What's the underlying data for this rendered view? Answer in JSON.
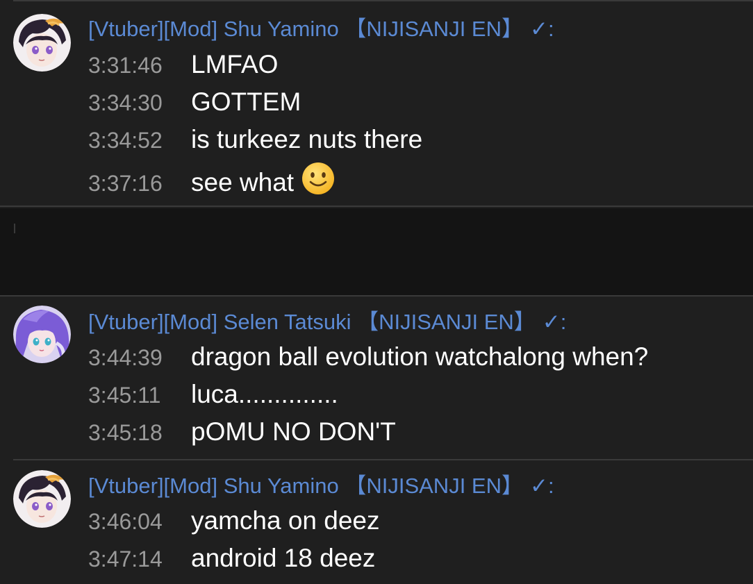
{
  "groups": [
    {
      "author": "[Vtuber][Mod] Shu Yamino 【NIJISANJI EN】",
      "check": "✓:",
      "avatar": "shu-yamino-avatar",
      "messages": [
        {
          "time": "3:31:46",
          "text": "LMFAO"
        },
        {
          "time": "3:34:30",
          "text": "GOTTEM"
        },
        {
          "time": "3:34:52",
          "text": "is turkeez nuts there"
        },
        {
          "time": "3:37:16",
          "text": "see what",
          "emoji": "slightly-smiling-face"
        }
      ]
    },
    {
      "author": "[Vtuber][Mod] Selen Tatsuki 【NIJISANJI EN】",
      "check": "✓:",
      "avatar": "selen-tatsuki-avatar",
      "messages": [
        {
          "time": "3:44:39",
          "text": "dragon ball evolution watchalong when?"
        },
        {
          "time": "3:45:11",
          "text": "luca.............."
        },
        {
          "time": "3:45:18",
          "text": "pOMU NO DON'T"
        }
      ]
    },
    {
      "author": "[Vtuber][Mod] Shu Yamino 【NIJISANJI EN】",
      "check": "✓:",
      "avatar": "shu-yamino-avatar",
      "messages": [
        {
          "time": "3:46:04",
          "text": "yamcha on deez"
        },
        {
          "time": "3:47:14",
          "text": "android 18 deez"
        }
      ]
    }
  ],
  "colors": {
    "background": "#1f1f1f",
    "author": "#5b8ad4",
    "timestamp": "#9a9a9a",
    "message": "#ffffff",
    "divider": "#3a3a3a"
  }
}
